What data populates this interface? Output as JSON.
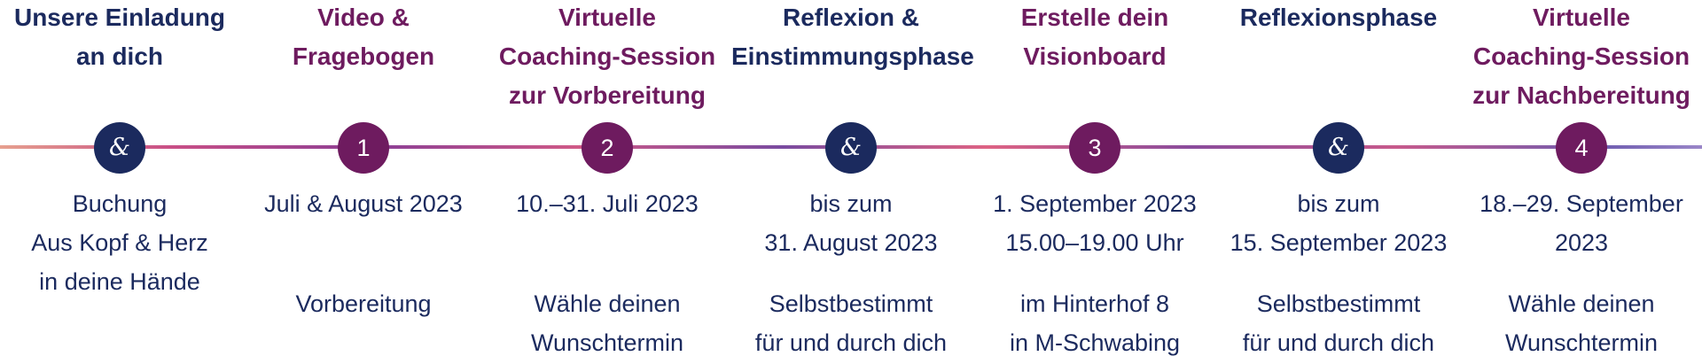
{
  "steps": [
    {
      "title": "Unsere Einladung\nan dich",
      "marker": "&",
      "date": "Buchung\nAus Kopf & Herz\nin deine Hände",
      "note": ""
    },
    {
      "title": "Video &\nFragebogen",
      "marker": "1",
      "date": "Juli & August 2023",
      "note": "Vorbereitung"
    },
    {
      "title": "Virtuelle\nCoaching-Session\nzur Vorbereitung",
      "marker": "2",
      "date": "10.–31. Juli 2023",
      "note": "Wähle deinen\nWunschtermin"
    },
    {
      "title": "Reflexion &\nEinstimmungsphase",
      "marker": "&",
      "date": "bis zum\n31. August 2023",
      "note": "Selbstbestimmt\nfür und durch dich"
    },
    {
      "title": "Erstelle dein\nVisionboard",
      "marker": "3",
      "date": "1. September 2023\n15.00–19.00 Uhr",
      "note": "im Hinterhof 8\nin M-Schwabing"
    },
    {
      "title": "Reflexionsphase",
      "marker": "&",
      "date": "bis zum\n15. September 2023",
      "note": "Selbstbestimmt\nfür und durch dich"
    },
    {
      "title": "Virtuelle\nCoaching-Session\nzur Nachbereitung",
      "marker": "4",
      "date": "18.–29. September\n2023",
      "note": "Wähle deinen\nWunschtermin"
    }
  ],
  "colors": {
    "navy": "#1b2a5e",
    "purple": "#6e1b5f"
  }
}
